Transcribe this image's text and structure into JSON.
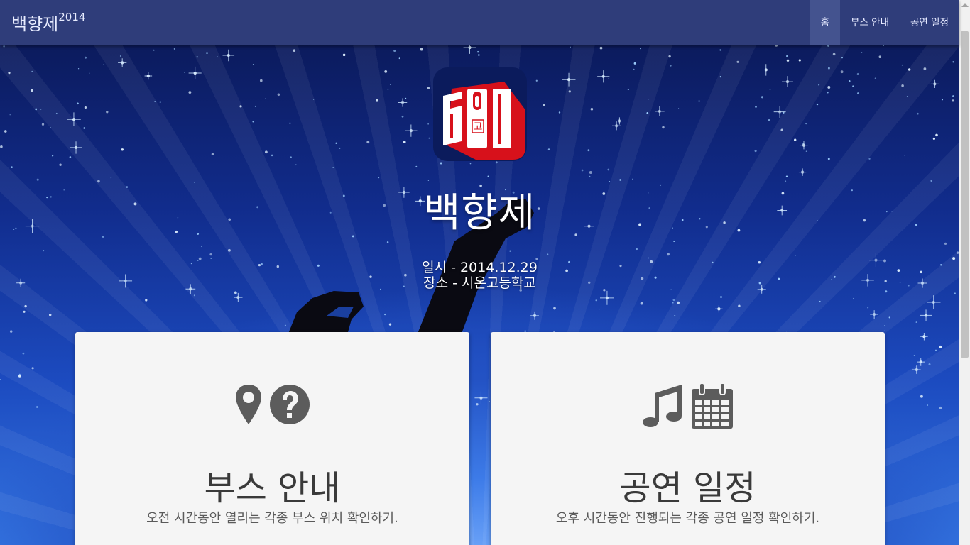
{
  "navbar": {
    "brand": "백향제",
    "brand_year": "2014",
    "items": [
      {
        "label": "홈",
        "active": true
      },
      {
        "label": "부스 안내",
        "active": false
      },
      {
        "label": "공연 일정",
        "active": false
      }
    ]
  },
  "hero": {
    "logo_char": "고",
    "title": "백향제",
    "date_line": "일시 - 2014.12.29",
    "place_line": "장소 - 시온고등학교"
  },
  "cards": [
    {
      "title": "부스 안내",
      "description": "오전 시간동안 열리는 각종 부스 위치 확인하기.",
      "icons": [
        "map-marker-icon",
        "question-circle-icon"
      ]
    },
    {
      "title": "공연 일정",
      "description": "오후 시간동안 진행되는 각종 공연 일정 확인하기.",
      "icons": [
        "music-icon",
        "calendar-icon"
      ]
    }
  ],
  "colors": {
    "navbar_bg": "#2f3d7a",
    "nav_active_bg": "#44538f",
    "card_bg": "#f5f5f5",
    "icon_gray": "#5c5c5c",
    "logo_red": "#d7111b",
    "logo_navy": "#0b1b5c"
  }
}
